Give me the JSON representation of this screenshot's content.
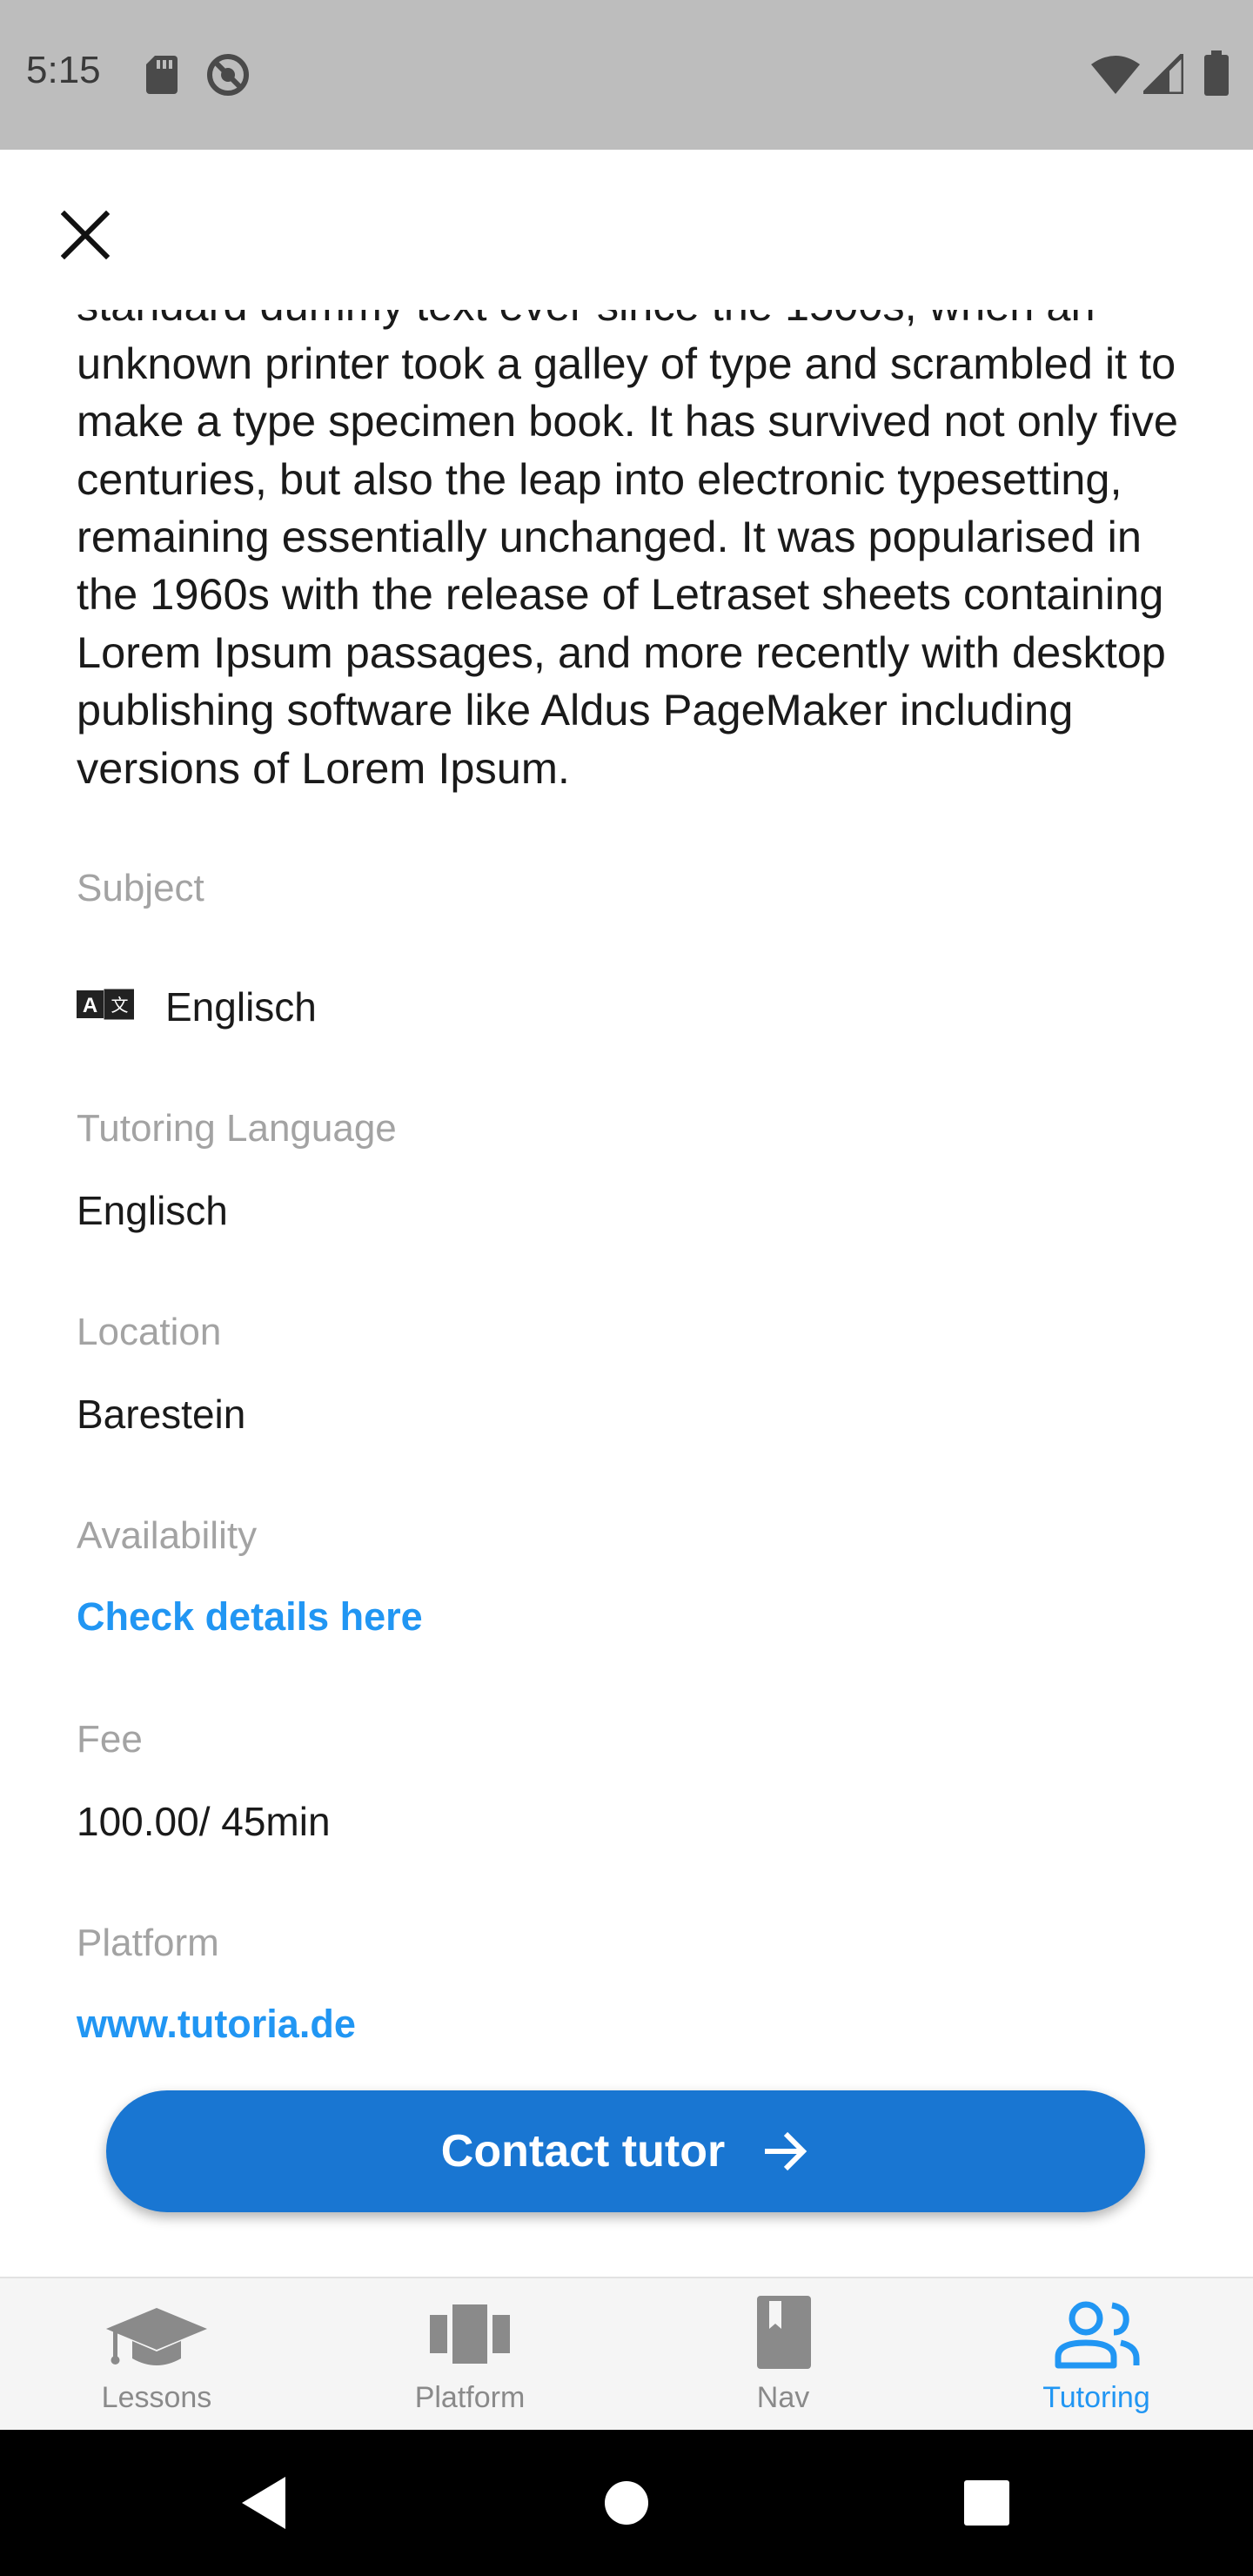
{
  "status_bar": {
    "time": "5:15",
    "icons": [
      "sd-card-icon",
      "do-not-disturb-icon",
      "wifi-icon",
      "signal-icon",
      "battery-icon"
    ]
  },
  "close_icon": "close-icon",
  "description": "Lorem Ipsum is simply dummy text of the printing and typesetting industry. Lorem Ipsum has been the industry's standard dummy text ever since the 1500s, when an unknown printer took a galley of type and scrambled it to make a type specimen book. It has survived not only five centuries, but also the leap into electronic typesetting, remaining essentially unchanged. It was popularised in the 1960s with the release of Letraset sheets containing Lorem Ipsum passages, and more recently with desktop publishing software like Aldus PageMaker including versions of Lorem Ipsum.",
  "fields": {
    "subject": {
      "label": "Subject",
      "value": "Englisch",
      "icon": "translate-icon"
    },
    "tutoring_language": {
      "label": "Tutoring Language",
      "value": "Englisch"
    },
    "location": {
      "label": "Location",
      "value": "Barestein"
    },
    "availability": {
      "label": "Availability",
      "link": "Check details here"
    },
    "fee": {
      "label": "Fee",
      "value": "100.00/ 45min"
    },
    "platform": {
      "label": "Platform",
      "link": "www.tutoria.de"
    }
  },
  "contact_button": {
    "label": "Contact tutor",
    "icon": "arrow-right-icon"
  },
  "colors": {
    "accent": "#2196f3",
    "button": "#1976d2",
    "label_gray": "#a3a3a3",
    "status_bar": "#bdbdbd"
  },
  "bottom_nav": {
    "items": [
      {
        "label": "Lessons",
        "icon": "graduation-cap-icon",
        "active": false
      },
      {
        "label": "Platform",
        "icon": "view-carousel-icon",
        "active": false
      },
      {
        "label": "Nav",
        "icon": "book-icon",
        "active": false
      },
      {
        "label": "Tutoring",
        "icon": "people-icon",
        "active": true
      }
    ]
  },
  "system_nav": {
    "buttons": [
      "back-icon",
      "home-icon",
      "recents-icon"
    ]
  }
}
